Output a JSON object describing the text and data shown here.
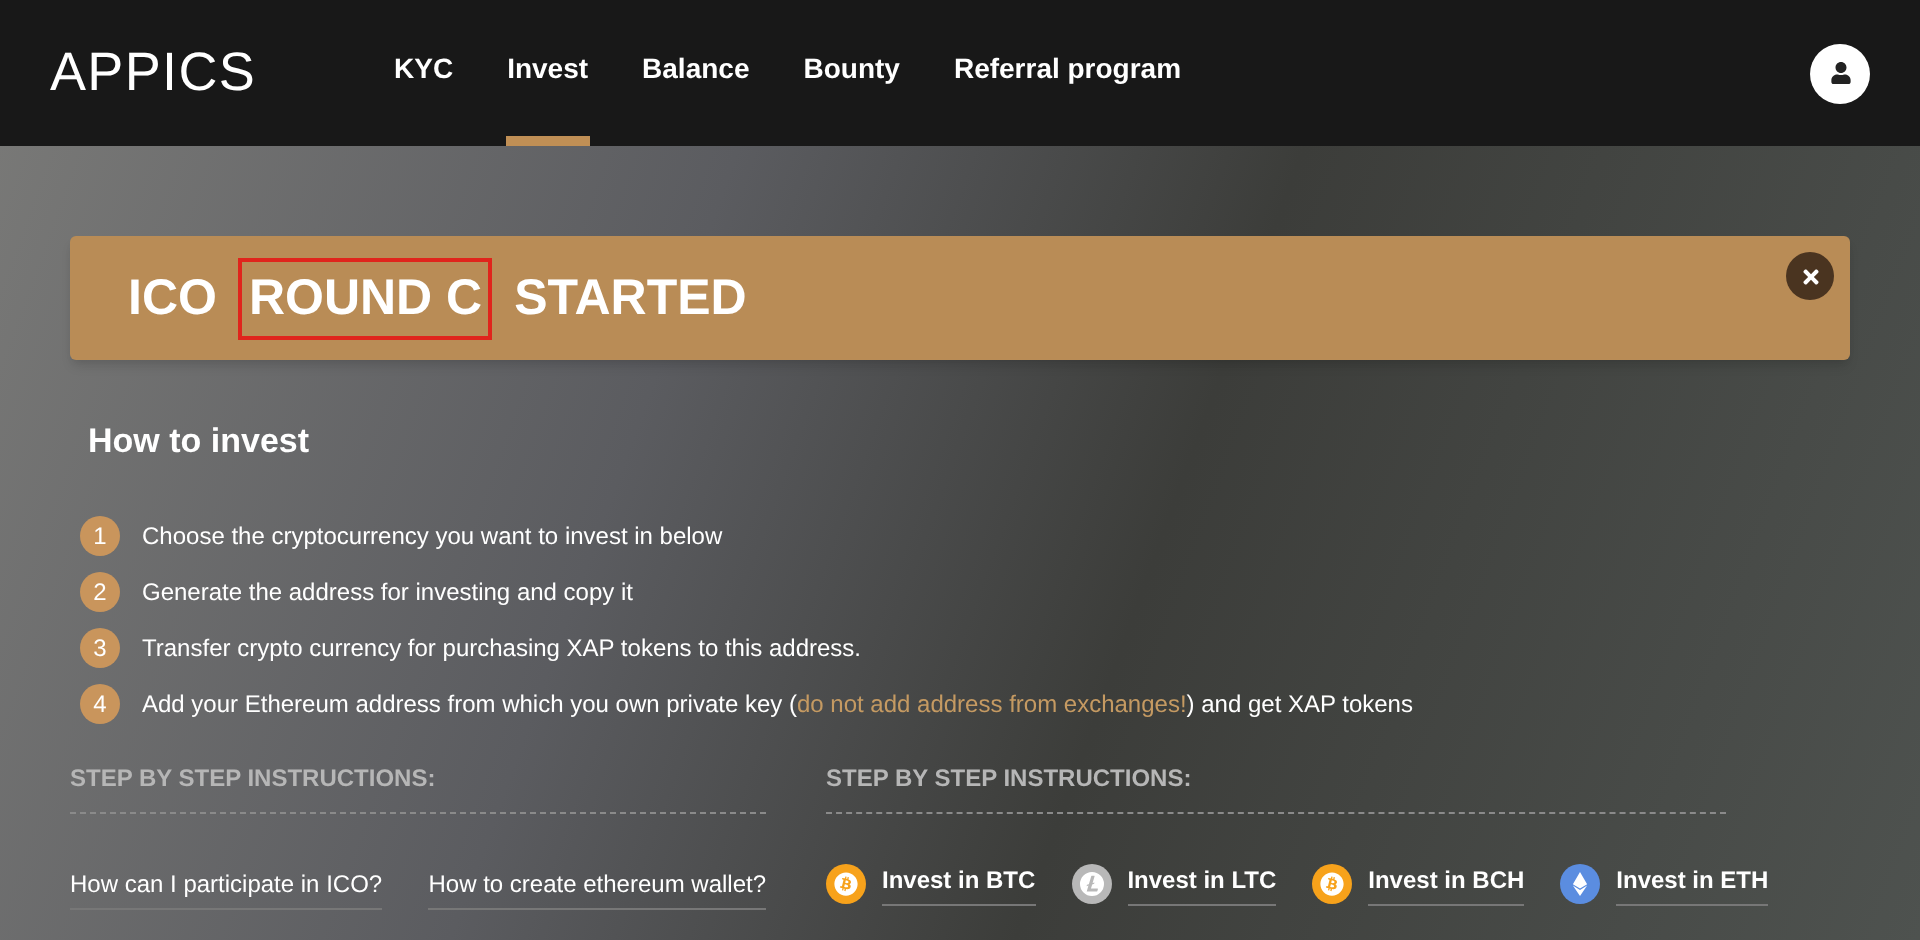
{
  "header": {
    "logo": "APPICS",
    "nav": [
      {
        "label": "KYC",
        "selected": false
      },
      {
        "label": "Invest",
        "selected": true
      },
      {
        "label": "Balance",
        "selected": false
      },
      {
        "label": "Bounty",
        "selected": false
      },
      {
        "label": "Referral program",
        "selected": false
      }
    ]
  },
  "banner": {
    "title_parts": [
      {
        "text": "ICO",
        "highlighted": false
      },
      {
        "text": "ROUND C",
        "highlighted": true
      },
      {
        "text": "STARTED",
        "highlighted": false
      }
    ]
  },
  "how_to": {
    "title": "How to invest",
    "steps": [
      {
        "number": "1",
        "text": "Choose the cryptocurrency you want to invest in below"
      },
      {
        "number": "2",
        "text": "Generate the address for investing and copy it"
      },
      {
        "number": "3",
        "text": "Transfer crypto currency for purchasing XAP tokens to this address."
      },
      {
        "number": "4",
        "text": "Add your Ethereum address from which you own private key (",
        "warning_text": "do not add address from exchanges!",
        "text_after": ") and get XAP tokens"
      }
    ]
  },
  "left_section": {
    "heading": "STEP BY STEP INSTRUCTIONS:",
    "links": [
      "How can I participate in ICO?",
      "How to create ethereum wallet?"
    ]
  },
  "right_section": {
    "heading": "STEP BY STEP INSTRUCTIONS:",
    "coins": [
      {
        "kind": "btc",
        "label": "Invest in BTC",
        "color": "#f7a21b"
      },
      {
        "kind": "ltc",
        "label": "Invest in LTC",
        "color": "#b8b8b8"
      },
      {
        "kind": "bch",
        "label": "Invest in BCH",
        "color": "#f7a21b"
      },
      {
        "kind": "eth",
        "label": "Invest in ETH",
        "color": "#5b8de0"
      }
    ]
  }
}
